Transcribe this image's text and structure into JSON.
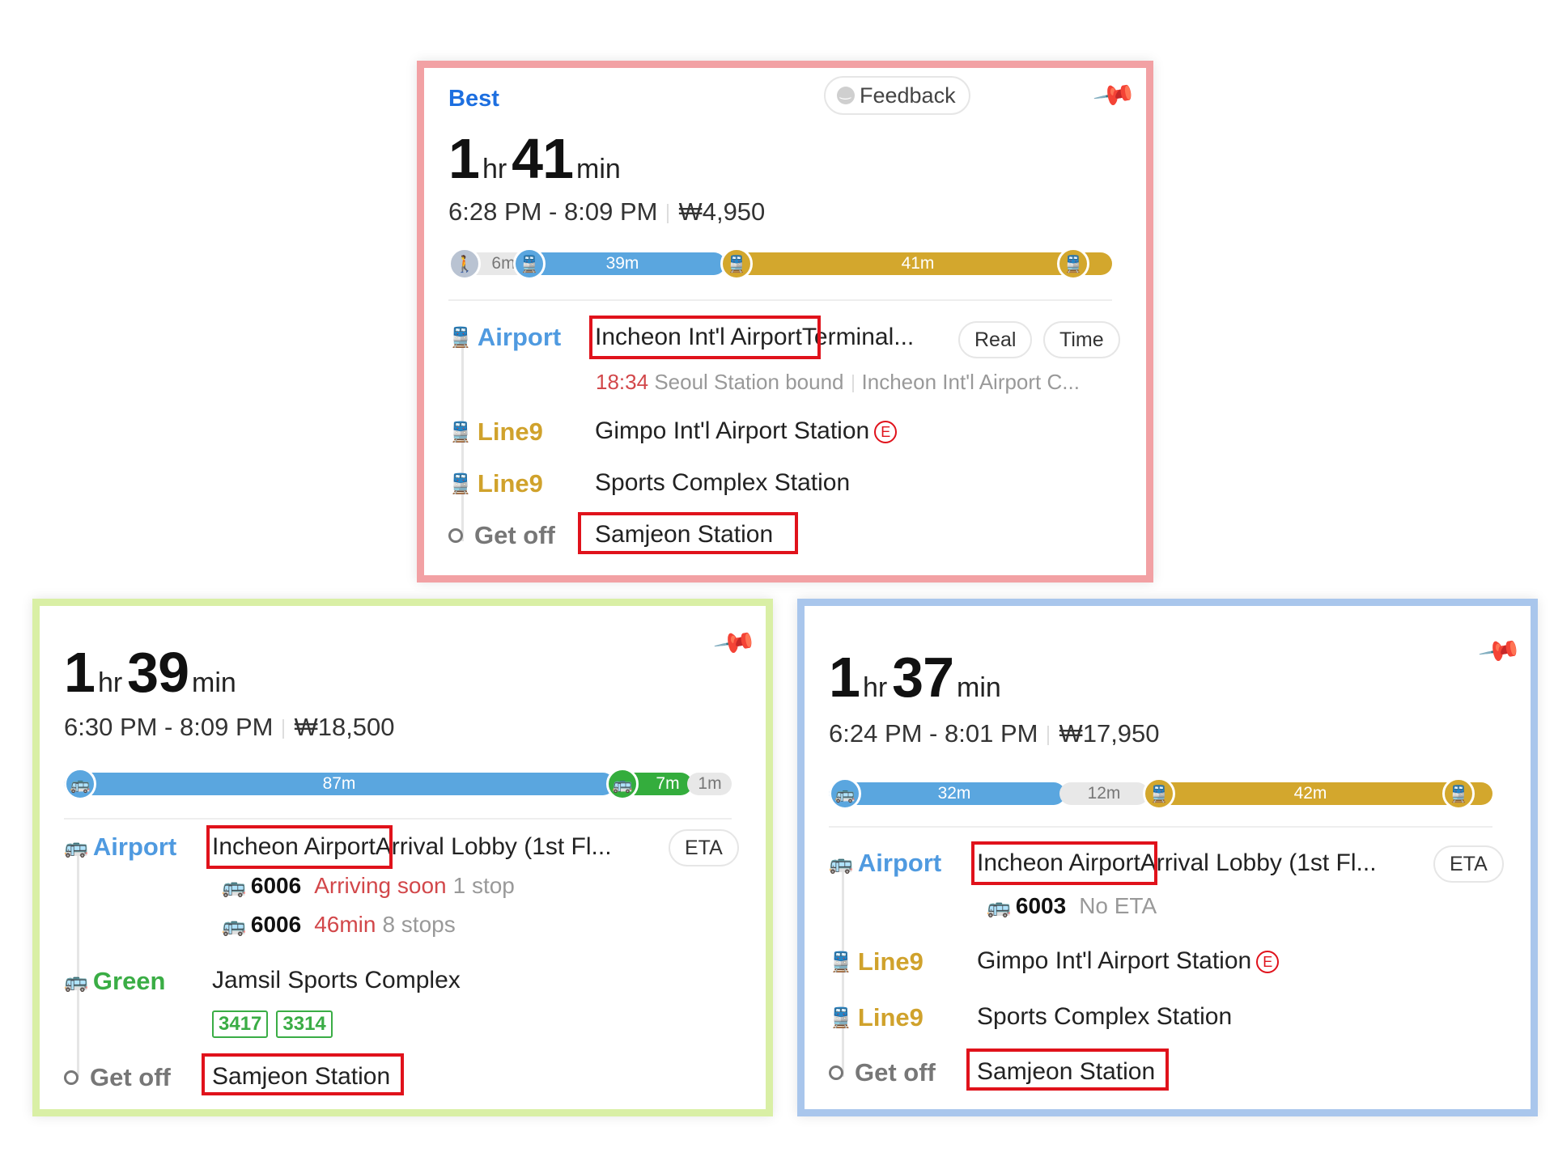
{
  "cards": {
    "best": {
      "badge": "Best",
      "feedback_label": "Feedback",
      "duration_hr": "1",
      "duration_min": "41",
      "unit_hr": "hr",
      "unit_min": "min",
      "time_range": "6:28 PM - 8:09 PM",
      "fare": "₩4,950",
      "bar": {
        "walk": "6m",
        "seg1": "39m",
        "seg2": "41m"
      },
      "rows": {
        "airport": {
          "type": "Airport",
          "stop_highlight": "Incheon Int'l Airport",
          "stop_rest": "Terminal...",
          "pill1": "Real",
          "pill2": "Time",
          "sub_time": "18:34",
          "sub_bound": "Seoul Station bound",
          "sub_dest": "Incheon Int'l Airport C..."
        },
        "line9a": {
          "type": "Line9",
          "stop": "Gimpo Int'l Airport Station",
          "badge": "E"
        },
        "line9b": {
          "type": "Line9",
          "stop": "Sports Complex Station"
        },
        "getoff": {
          "type": "Get off",
          "stop": "Samjeon Station"
        }
      }
    },
    "green": {
      "duration_hr": "1",
      "duration_min": "39",
      "unit_hr": "hr",
      "unit_min": "min",
      "time_range": "6:30 PM - 8:09 PM",
      "fare": "₩18,500",
      "bar": {
        "seg1": "87m",
        "seg2": "7m",
        "seg3": "1m"
      },
      "rows": {
        "airport": {
          "type": "Airport",
          "stop_highlight": "Incheon Airport",
          "stop_rest": "Arrival Lobby (1st Fl...",
          "pill": "ETA",
          "buses": [
            {
              "num": "6006",
              "status": "Arriving soon",
              "info": "1 stop"
            },
            {
              "num": "6006",
              "status": "46min",
              "info": "8 stops"
            }
          ]
        },
        "green": {
          "type": "Green",
          "stop": "Jamsil Sports Complex",
          "chips": [
            "3417",
            "3314"
          ]
        },
        "getoff": {
          "type": "Get off",
          "stop": "Samjeon Station"
        }
      }
    },
    "blue": {
      "duration_hr": "1",
      "duration_min": "37",
      "unit_hr": "hr",
      "unit_min": "min",
      "time_range": "6:24 PM - 8:01 PM",
      "fare": "₩17,950",
      "bar": {
        "seg1": "32m",
        "walk": "12m",
        "seg2": "42m"
      },
      "rows": {
        "airport": {
          "type": "Airport",
          "stop_highlight": "Incheon Airport",
          "stop_rest": "Arrival Lobby (1st Fl...",
          "pill": "ETA",
          "bus": {
            "num": "6003",
            "status": "No ETA"
          }
        },
        "line9a": {
          "type": "Line9",
          "stop": "Gimpo Int'l Airport Station",
          "badge": "E"
        },
        "line9b": {
          "type": "Line9",
          "stop": "Sports Complex Station"
        },
        "getoff": {
          "type": "Get off",
          "stop": "Samjeon Station"
        }
      }
    }
  },
  "colors": {
    "bus_blue": "#5aa6df",
    "line9_gold": "#d3a72d",
    "green_line": "#34ad3d",
    "walk_grey": "#e8e8e8",
    "highlight_red": "#e0121b",
    "best_blue": "#1d6fe0"
  },
  "icons": {
    "bus": "bus-icon",
    "train": "train-icon",
    "walk": "walk-icon",
    "pin": "pin-icon",
    "feedback": "smiley-icon"
  }
}
